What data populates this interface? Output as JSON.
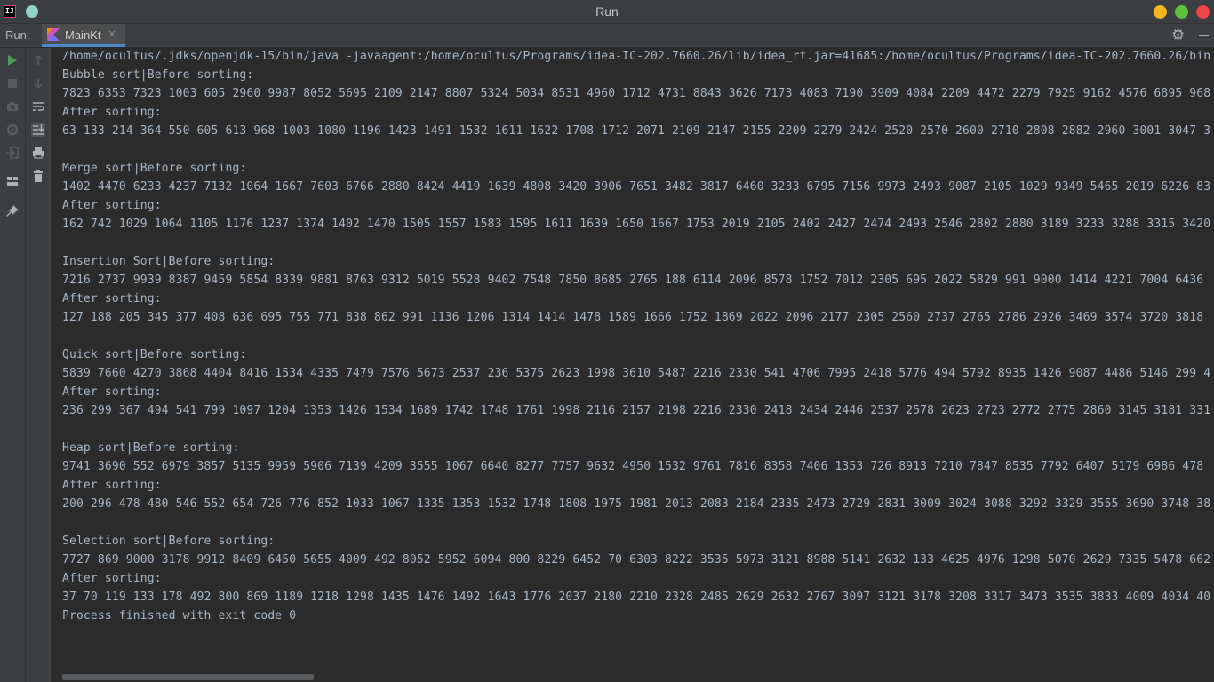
{
  "window": {
    "title": "Run"
  },
  "runbar": {
    "label": "Run:",
    "tab_label": "MainKt",
    "tab_close": "×"
  },
  "console": {
    "lines": [
      "/home/ocultus/.jdks/openjdk-15/bin/java -javaagent:/home/ocultus/Programs/idea-IC-202.7660.26/lib/idea_rt.jar=41685:/home/ocultus/Programs/idea-IC-202.7660.26/bin",
      "Bubble sort|Before sorting:",
      "7823 6353 7323 1003 605 2960 9987 8052 5695 2109 2147 8807 5324 5034 8531 4960 1712 4731 8843 3626 7173 4083 7190 3909 4084 2209 4472 2279 7925 9162 4576 6895 968",
      "After sorting:",
      "63 133 214 364 550 605 613 968 1003 1080 1196 1423 1491 1532 1611 1622 1708 1712 2071 2109 2147 2155 2209 2279 2424 2520 2570 2600 2710 2808 2882 2960 3001 3047 3",
      "",
      "Merge sort|Before sorting:",
      "1402 4470 6233 4237 7132 1064 1667 7603 6766 2880 8424 4419 1639 4808 3420 3906 7651 3482 3817 6460 3233 6795 7156 9973 2493 9087 2105 1029 9349 5465 2019 6226 83",
      "After sorting:",
      "162 742 1029 1064 1105 1176 1237 1374 1402 1470 1505 1557 1583 1595 1611 1639 1650 1667 1753 2019 2105 2402 2427 2474 2493 2546 2802 2880 3189 3233 3288 3315 3420",
      "",
      "Insertion Sort|Before sorting:",
      "7216 2737 9939 8387 9459 5854 8339 9881 8763 9312 5019 5528 9402 7548 7850 8685 2765 188 6114 2096 8578 1752 7012 2305 695 2022 5829 991 9000 1414 4221 7004 6436",
      "After sorting:",
      "127 188 205 345 377 408 636 695 755 771 838 862 991 1136 1206 1314 1414 1478 1589 1666 1752 1869 2022 2096 2177 2305 2560 2737 2765 2786 2926 3469 3574 3720 3818",
      "",
      "Quick sort|Before sorting:",
      "5839 7660 4270 3868 4404 8416 1534 4335 7479 7576 5673 2537 236 5375 2623 1998 3610 5487 2216 2330 541 4706 7995 2418 5776 494 5792 8935 1426 9087 4486 5146 299 4",
      "After sorting:",
      "236 299 367 494 541 799 1097 1204 1353 1426 1534 1689 1742 1748 1761 1998 2116 2157 2198 2216 2330 2418 2434 2446 2537 2578 2623 2723 2772 2775 2860 3145 3181 331",
      "",
      "Heap sort|Before sorting:",
      "9741 3690 552 6979 3857 5135 9959 5906 7139 4209 3555 1067 6640 8277 7757 9632 4950 1532 9761 7816 8358 7406 1353 726 8913 7210 7847 8535 7792 6407 5179 6986 478",
      "After sorting:",
      "200 296 478 480 546 552 654 726 776 852 1033 1067 1335 1353 1532 1748 1808 1975 1981 2013 2083 2184 2335 2473 2729 2831 3009 3024 3088 3292 3329 3555 3690 3748 38",
      "",
      "Selection sort|Before sorting:",
      "7727 869 9000 3178 9912 8409 6450 5655 4009 492 8052 5952 6094 800 8229 6452 70 6303 8222 3535 5973 3121 8988 5141 2632 133 4625 4976 1298 5070 2629 7335 5478 662",
      "After sorting:",
      "37 70 119 133 178 492 800 869 1189 1218 1298 1435 1476 1492 1643 1776 2037 2180 2210 2328 2485 2629 2632 2767 3097 3121 3178 3208 3317 3473 3535 3833 4009 4034 40",
      "Process finished with exit code 0"
    ]
  }
}
